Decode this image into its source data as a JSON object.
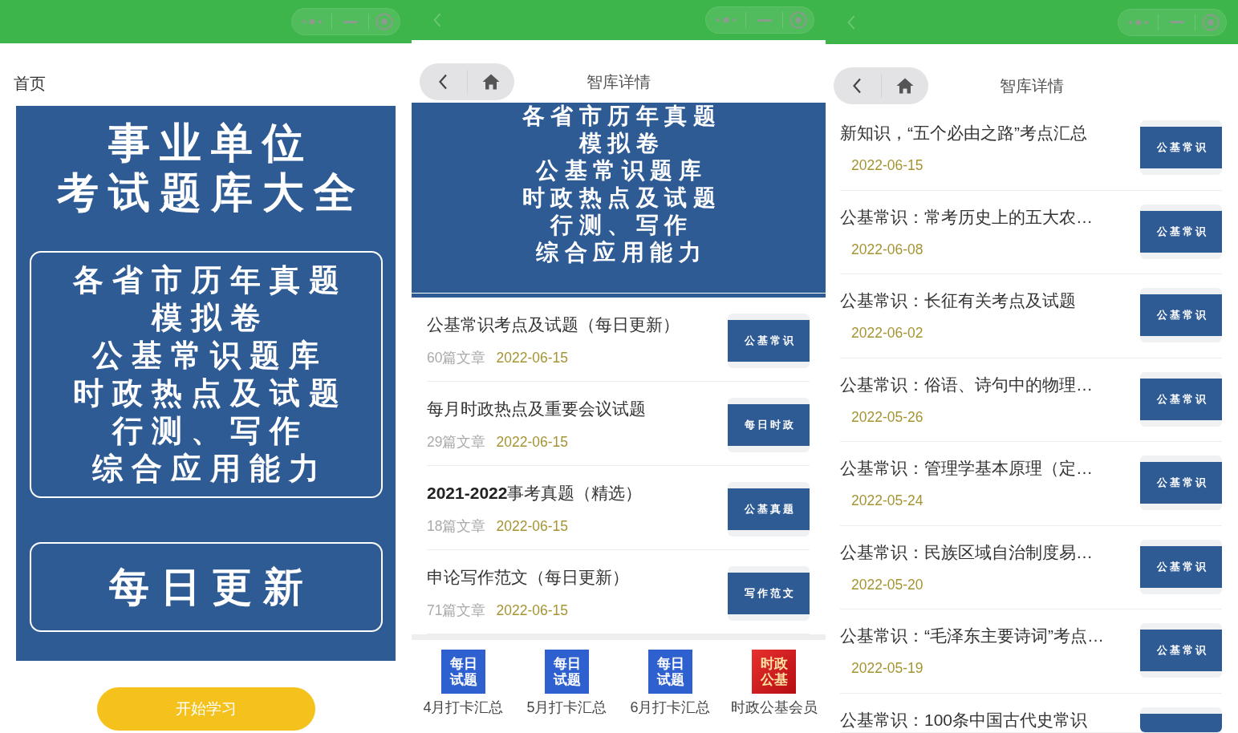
{
  "home_screen": {
    "title": "首页",
    "poster": {
      "headline": [
        "事业单位",
        "考试题库大全"
      ],
      "topics": [
        "各省市历年真题",
        "模拟卷",
        "公基常识题库",
        "时政热点及试题",
        "行测、写作",
        "综合应用能力"
      ],
      "tagline": "每日更新"
    },
    "start_button": "开始学习"
  },
  "category_screen": {
    "top_bar": {
      "back_arrow": true
    },
    "nav": {
      "title": "智库详情"
    },
    "banner": {
      "topics": [
        "各省市历年真题",
        "模拟卷",
        "公基常识题库",
        "时政热点及试题",
        "行测、写作",
        "综合应用能力"
      ]
    },
    "categories": [
      {
        "title": "公基常识考点及试题（每日更新）",
        "count": "60篇文章",
        "date": "2022-06-15",
        "thumbnail": "公基常识"
      },
      {
        "title": "每月时政热点及重要会议试题",
        "count": "29篇文章",
        "date": "2022-06-15",
        "thumbnail": "每日时政"
      },
      {
        "title": "**2021-2022**事考真题（精选）",
        "count": "18篇文章",
        "date": "2022-06-15",
        "thumbnail": "公基真题"
      },
      {
        "title": "申论写作范文（每日更新）",
        "count": "71篇文章",
        "date": "2022-06-15",
        "thumbnail": "写作范文"
      }
    ],
    "shortcuts": [
      {
        "kind": "daily",
        "tile": "每日试题",
        "label": "4月打卡汇总"
      },
      {
        "kind": "daily",
        "tile": "每日试题",
        "label": "5月打卡汇总"
      },
      {
        "kind": "daily",
        "tile": "每日试题",
        "label": "6月打卡汇总"
      },
      {
        "kind": "member",
        "tile": "时政公基",
        "label": "时政公基会员"
      }
    ]
  },
  "article_screen": {
    "top_bar": {
      "back_arrow": true
    },
    "nav": {
      "title": "智库详情"
    },
    "articles": [
      {
        "title": "新知识，“五个必由之路”考点汇总",
        "date": "2022-06-15",
        "thumbnail": "公基常识"
      },
      {
        "title": "公基常识：常考历史上的五大农…",
        "date": "2022-06-08",
        "thumbnail": "公基常识"
      },
      {
        "title": "公基常识：长征有关考点及试题",
        "date": "2022-06-02",
        "thumbnail": "公基常识"
      },
      {
        "title": "公基常识：俗语、诗句中的物理…",
        "date": "2022-05-26",
        "thumbnail": "公基常识"
      },
      {
        "title": "公基常识：管理学基本原理（定…",
        "date": "2022-05-24",
        "thumbnail": "公基常识"
      },
      {
        "title": "公基常识：民族区域自治制度易…",
        "date": "2022-05-20",
        "thumbnail": "公基常识"
      },
      {
        "title": "公基常识：“毛泽东主要诗词”考点…",
        "date": "2022-05-19",
        "thumbnail": "公基常识"
      },
      {
        "title": "公基常识：100条中国古代史常识"
      }
    ]
  }
}
